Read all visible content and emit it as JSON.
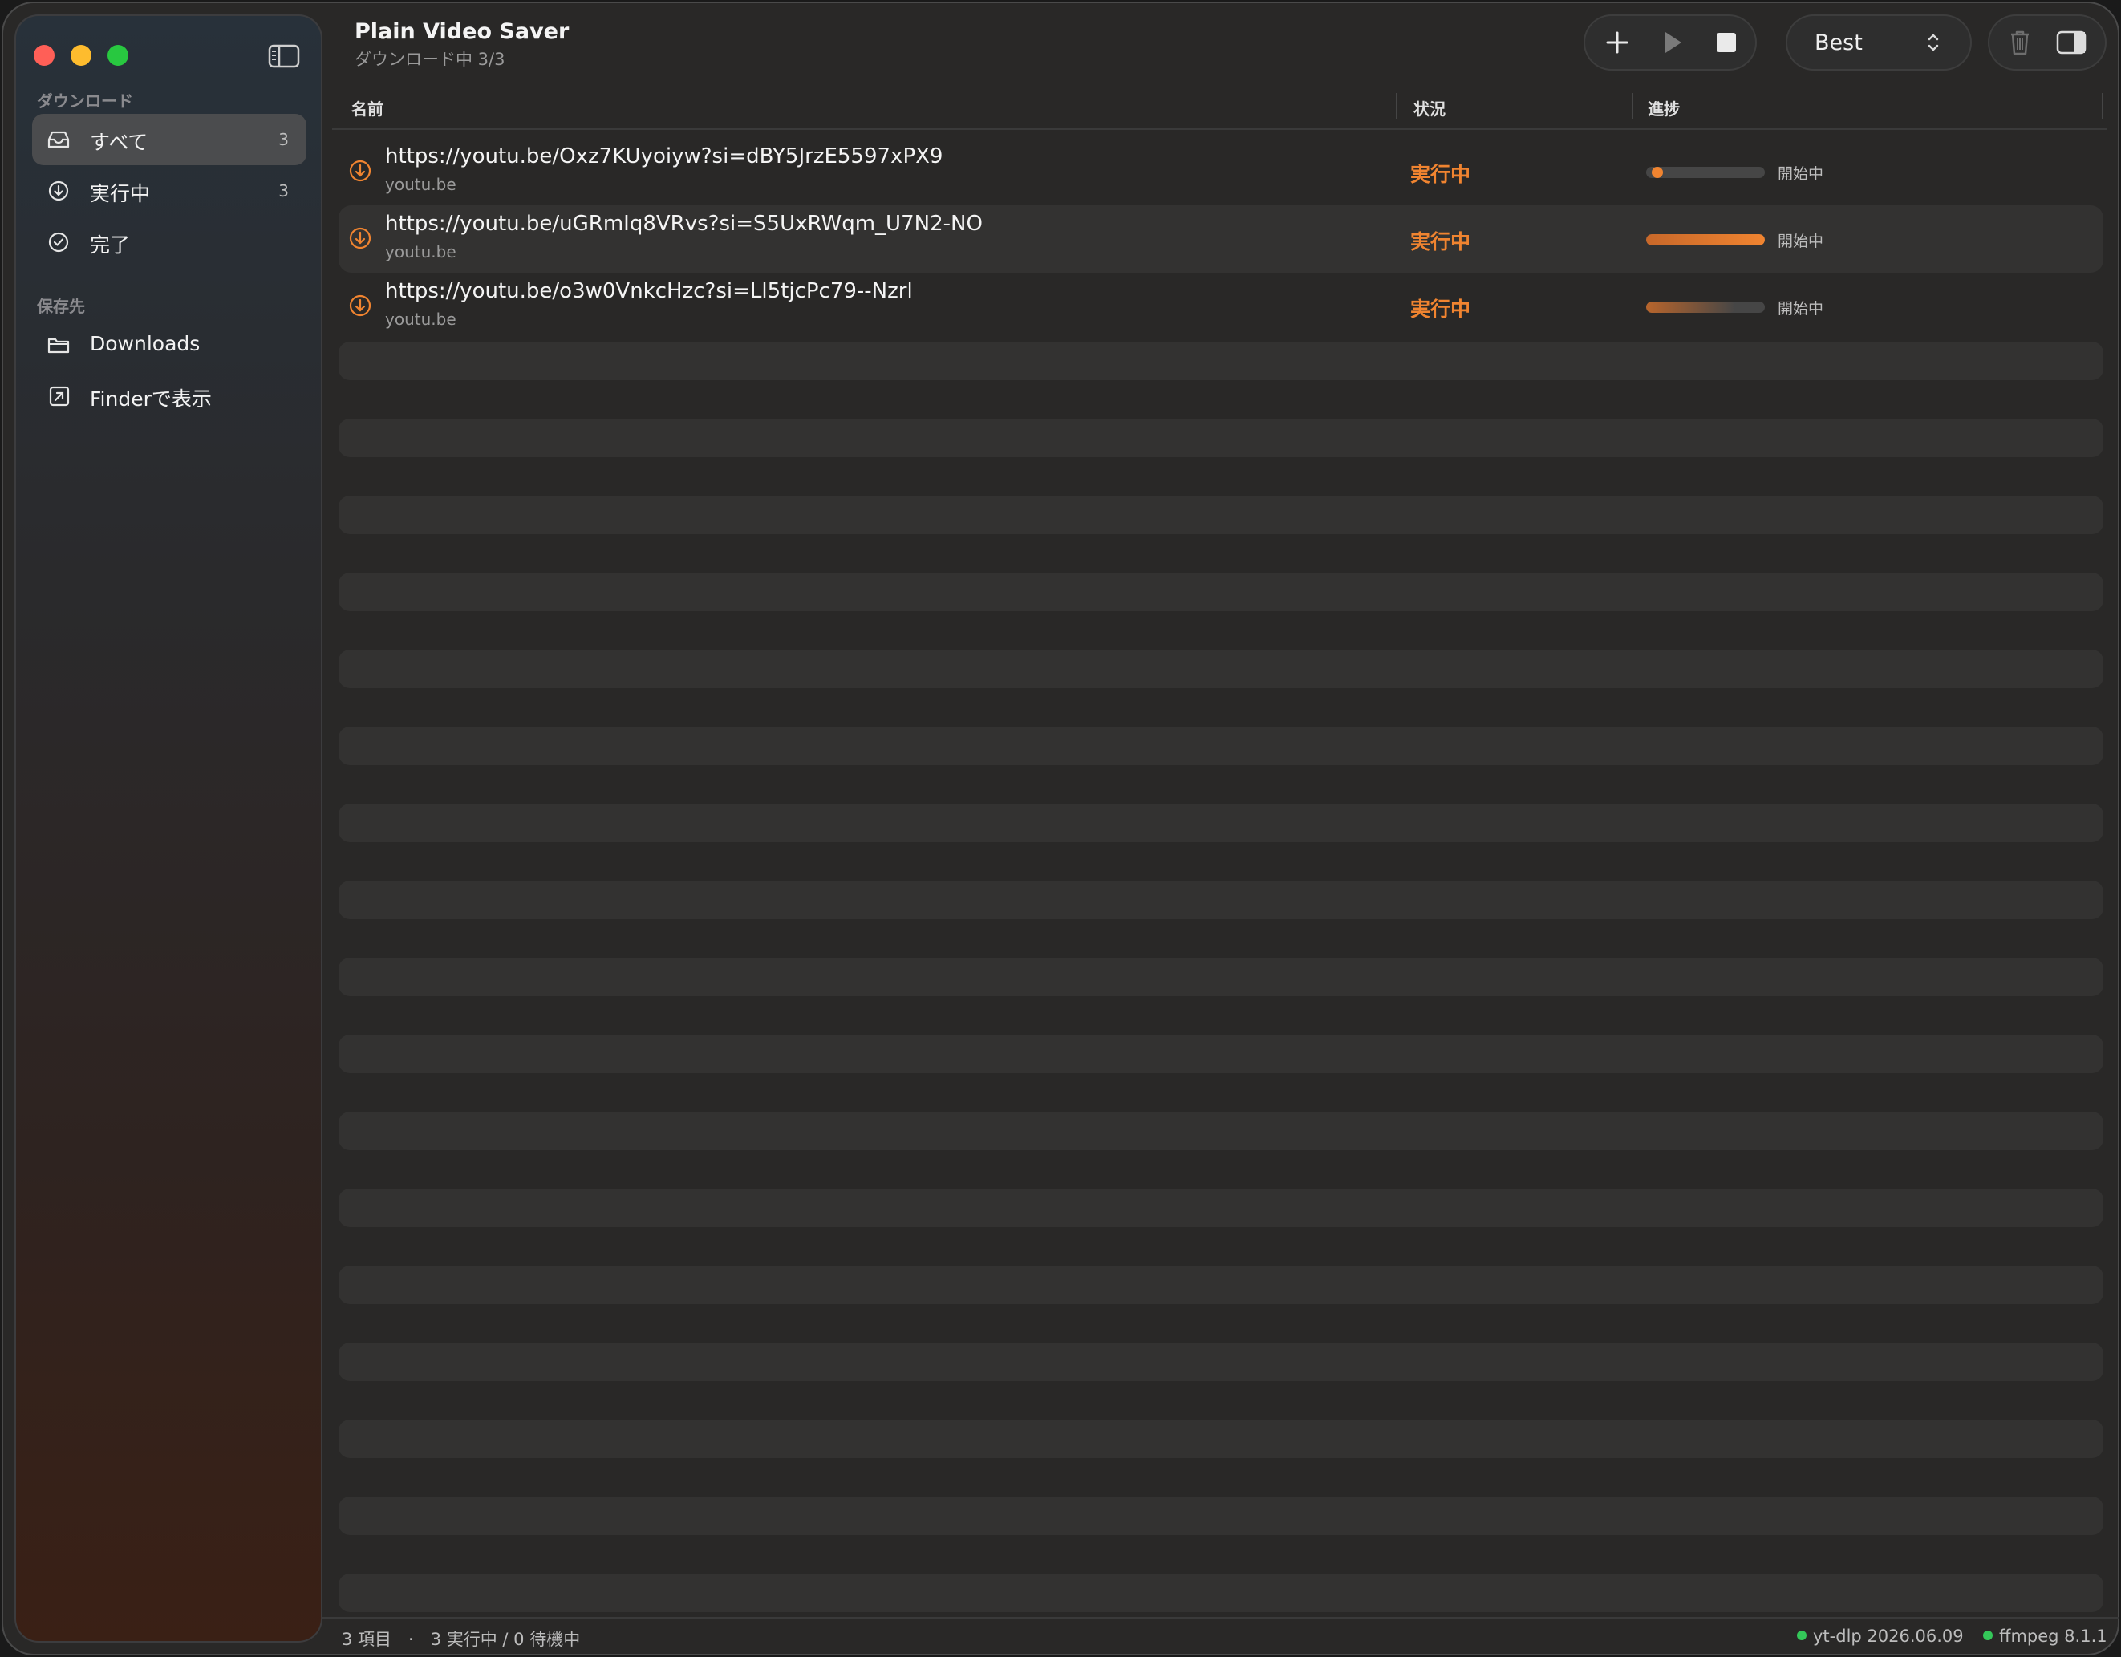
{
  "window": {
    "title": "Plain Video Saver",
    "subtitle": "ダウンロード中 3/3"
  },
  "toolbar": {
    "add_icon": "plus-icon",
    "play_icon": "play-icon",
    "stop_icon": "stop-icon",
    "format_value": "Best",
    "trash_icon": "trash-icon",
    "inspector_icon": "sidebar-right-icon"
  },
  "sidebar": {
    "downloads_section": "ダウンロード",
    "items": [
      {
        "label": "すべて",
        "count": "3",
        "icon": "tray-icon",
        "selected": true
      },
      {
        "label": "実行中",
        "count": "3",
        "icon": "arrow-down-circle-icon",
        "selected": false
      },
      {
        "label": "完了",
        "count": "",
        "icon": "checkmark-circle-icon",
        "selected": false
      }
    ],
    "save_section": "保存先",
    "save_items": [
      {
        "label": "Downloads",
        "icon": "folder-icon"
      },
      {
        "label": "Finderで表示",
        "icon": "arrow-up-right-square-icon"
      }
    ]
  },
  "table": {
    "columns": [
      "名前",
      "状況",
      "進捗"
    ],
    "rows": [
      {
        "title": "https://youtu.be/Oxz7KUyoiyw?si=dBY5JrzE5597xPX9",
        "host": "youtu.be",
        "status": "実行中",
        "progress_label": "開始中",
        "progress": 0.05
      },
      {
        "title": "https://youtu.be/uGRmIq8VRvs?si=S5UxRWqm_U7N2-NO",
        "host": "youtu.be",
        "status": "実行中",
        "progress_label": "開始中",
        "progress": 1.0
      },
      {
        "title": "https://youtu.be/o3w0VnkcHzc?si=Ll5tjcPc79--Nzrl",
        "host": "youtu.be",
        "status": "実行中",
        "progress_label": "開始中",
        "progress": 0.75
      }
    ]
  },
  "statusbar": {
    "summary": "3 項目　·　3 実行中 / 0 待機中",
    "ytdlp": "yt-dlp 2026.06.09",
    "ffmpeg": "ffmpeg 8.1.1"
  },
  "colors": {
    "accent": "#f08430",
    "status_ok": "#34c759",
    "close": "#ff5f57",
    "minimize": "#febc2e",
    "zoom": "#28c840"
  }
}
